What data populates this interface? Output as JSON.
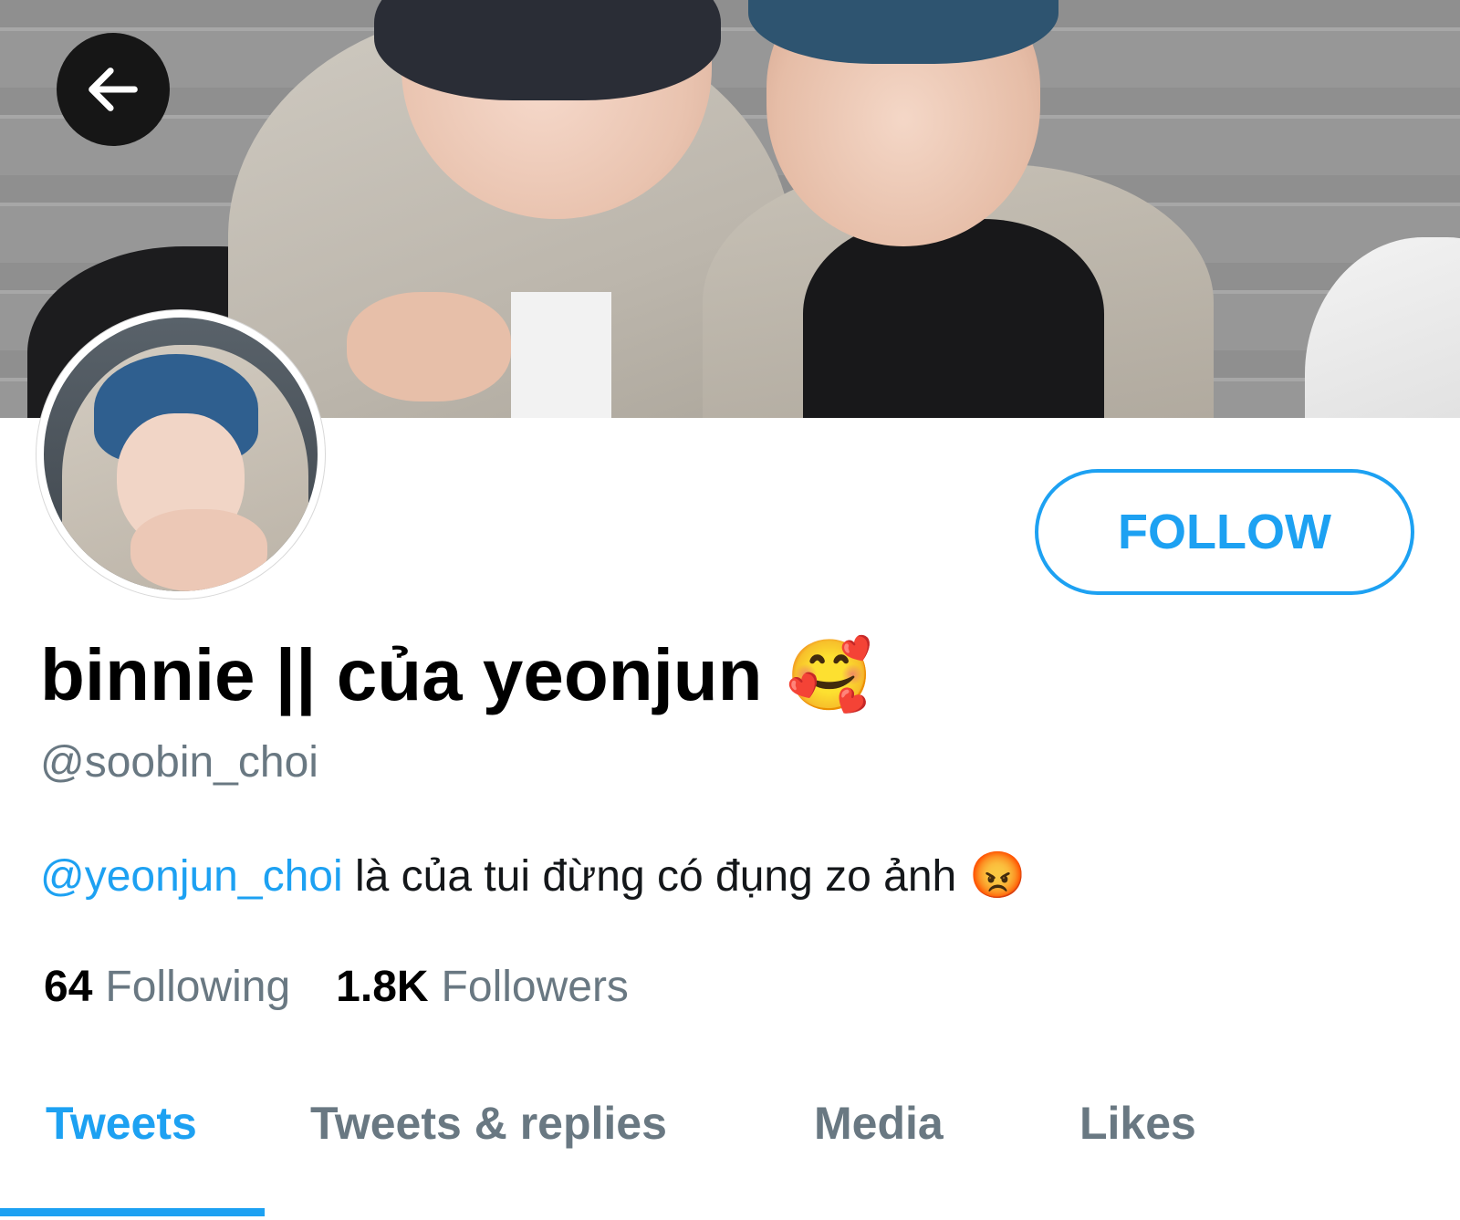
{
  "colors": {
    "accent": "#1da1f2",
    "secondary_text": "#697882",
    "primary_text": "#000000"
  },
  "header": {
    "back_icon": "arrow-left-icon"
  },
  "profile": {
    "display_name": "binnie || của yeonjun",
    "display_name_emoji": "🥰",
    "handle": "@soobin_choi",
    "follow_label": "FOLLOW",
    "bio": {
      "mention": "@yeonjun_choi",
      "text": " là của tui đừng có đụng zo ảnh",
      "emoji": "😡"
    },
    "stats": {
      "following_count": "64",
      "following_label": "Following",
      "followers_count": "1.8K",
      "followers_label": "Followers"
    }
  },
  "tabs": [
    {
      "label": "Tweets",
      "active": true
    },
    {
      "label": "Tweets & replies",
      "active": false
    },
    {
      "label": "Media",
      "active": false
    },
    {
      "label": "Likes",
      "active": false
    }
  ]
}
